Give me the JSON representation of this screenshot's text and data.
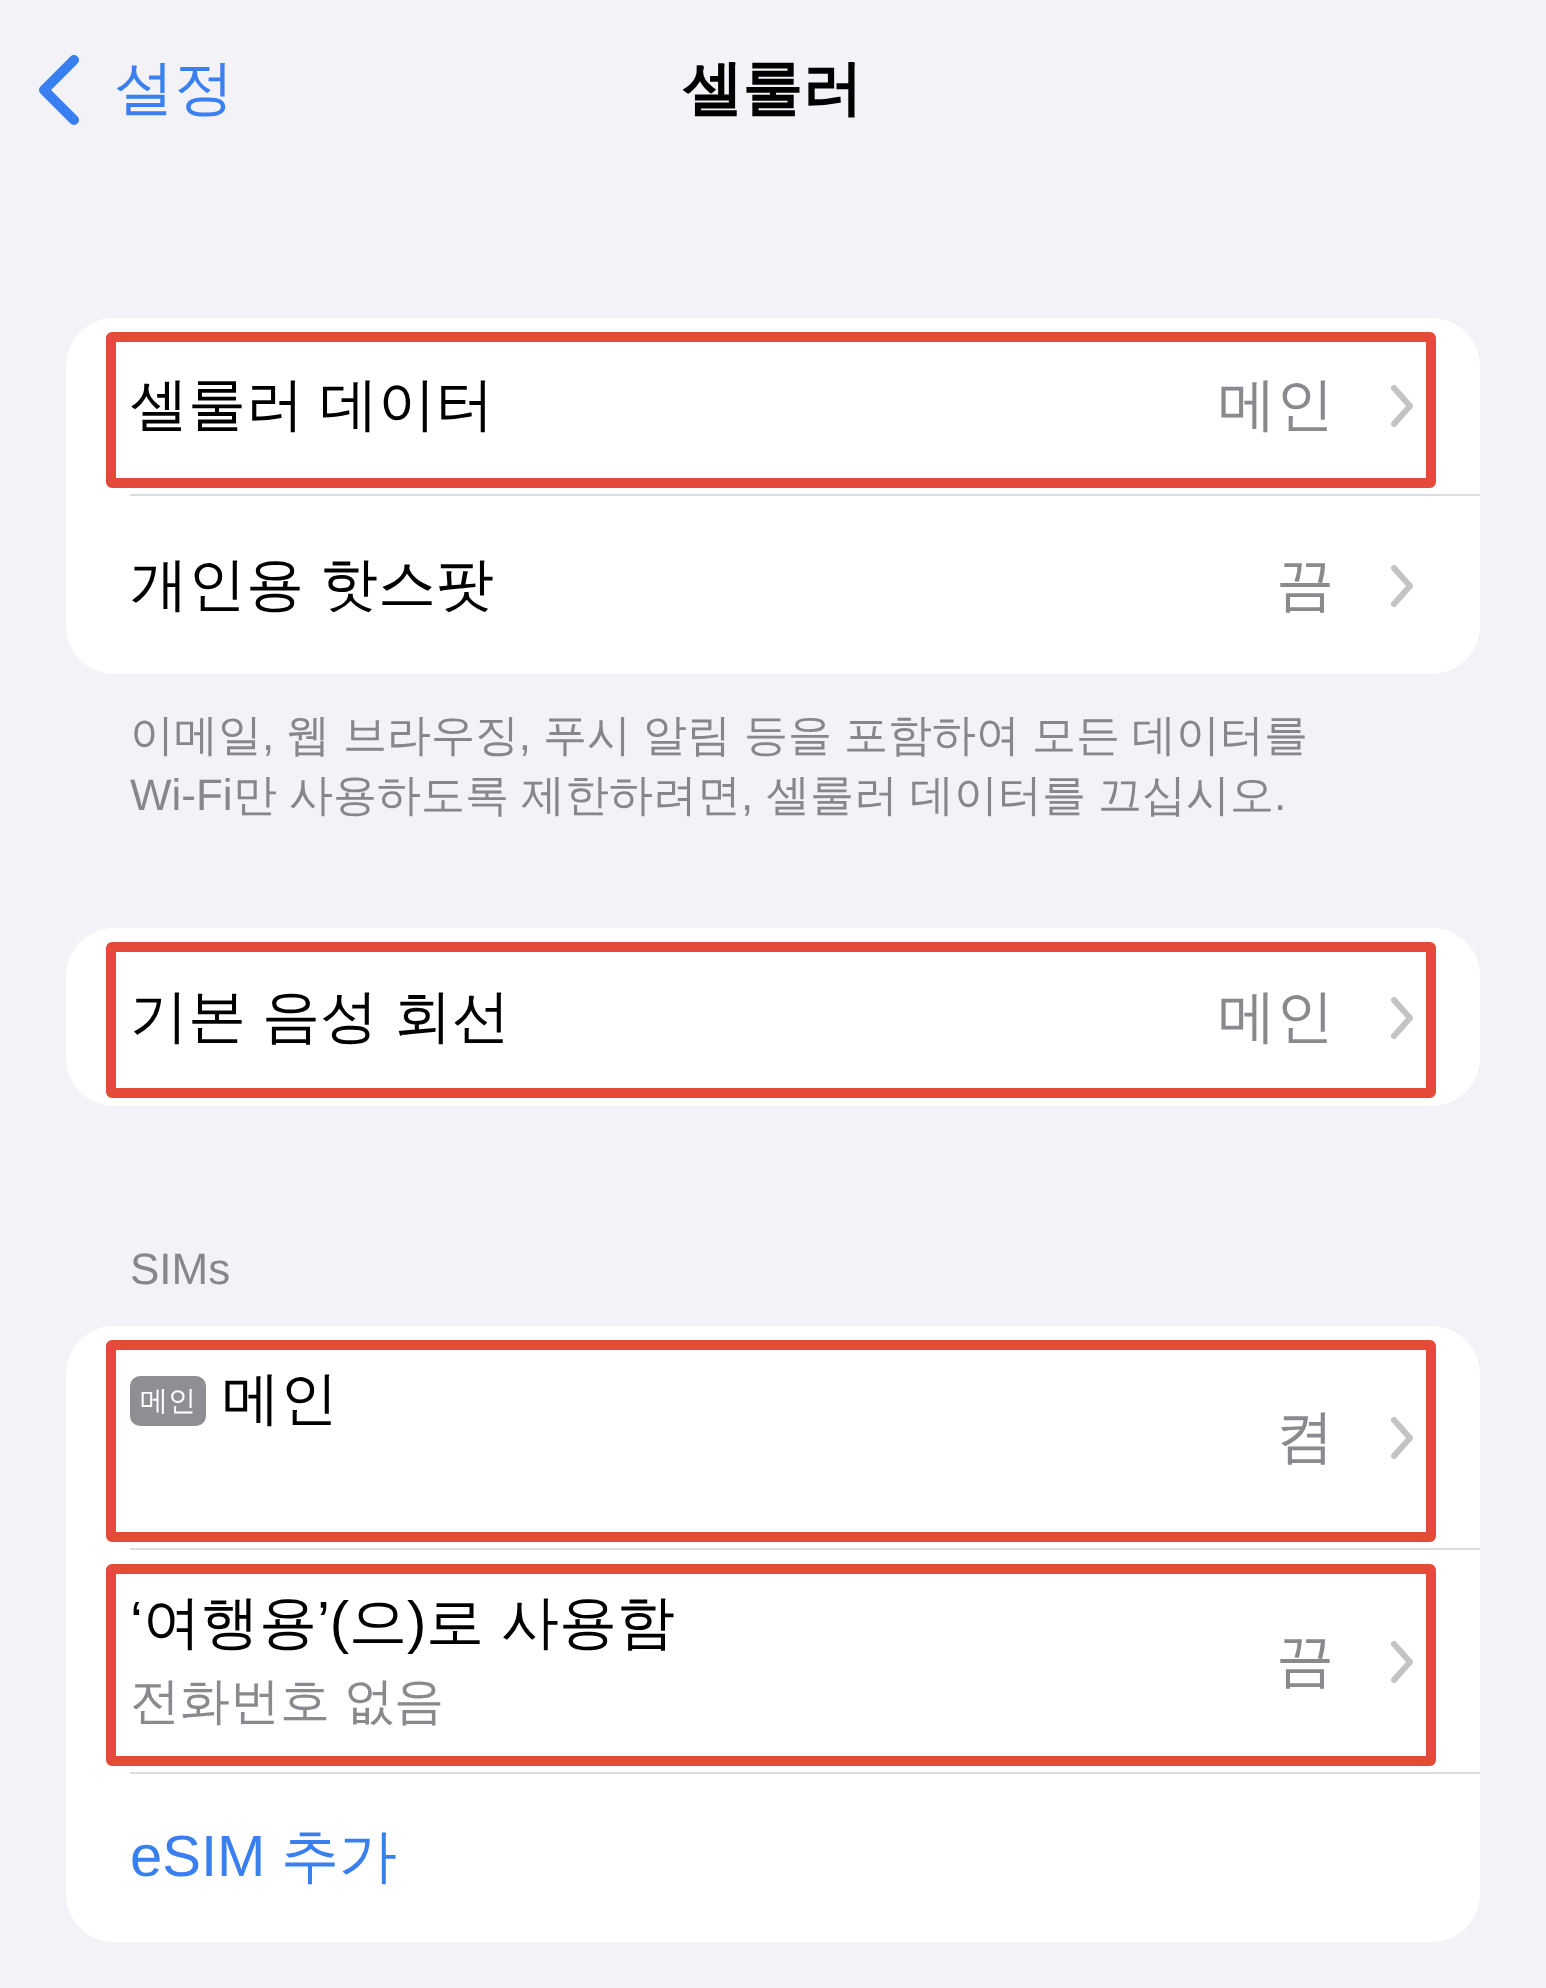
{
  "nav": {
    "back": "설정",
    "title": "셀룰러"
  },
  "sections": [
    {
      "rows": [
        {
          "kind": "value",
          "label": "셀룰러 데이터",
          "value": "메인",
          "highlighted": true
        },
        {
          "kind": "value",
          "label": "개인용 핫스팟",
          "value": "끔",
          "highlighted": false
        }
      ],
      "footer": "이메일, 웹 브라우징, 푸시 알림 등을 포함하여 모든 데이터를\nWi-Fi만 사용하도록 제한하려면, 셀룰러 데이터를 끄십시오."
    },
    {
      "rows": [
        {
          "kind": "value",
          "label": "기본 음성 회선",
          "value": "메인",
          "highlighted": true
        }
      ]
    },
    {
      "header": "SIMs",
      "rows": [
        {
          "kind": "sim",
          "badge": "메인",
          "label": "메인",
          "value": "켬",
          "highlighted": true
        },
        {
          "kind": "sim",
          "label": "‘여행용’(으)로 사용함",
          "subtitle": "전화번호 없음",
          "value": "끔",
          "highlighted": true
        },
        {
          "kind": "action",
          "label": "eSIM 추가",
          "highlighted": false
        }
      ]
    }
  ]
}
